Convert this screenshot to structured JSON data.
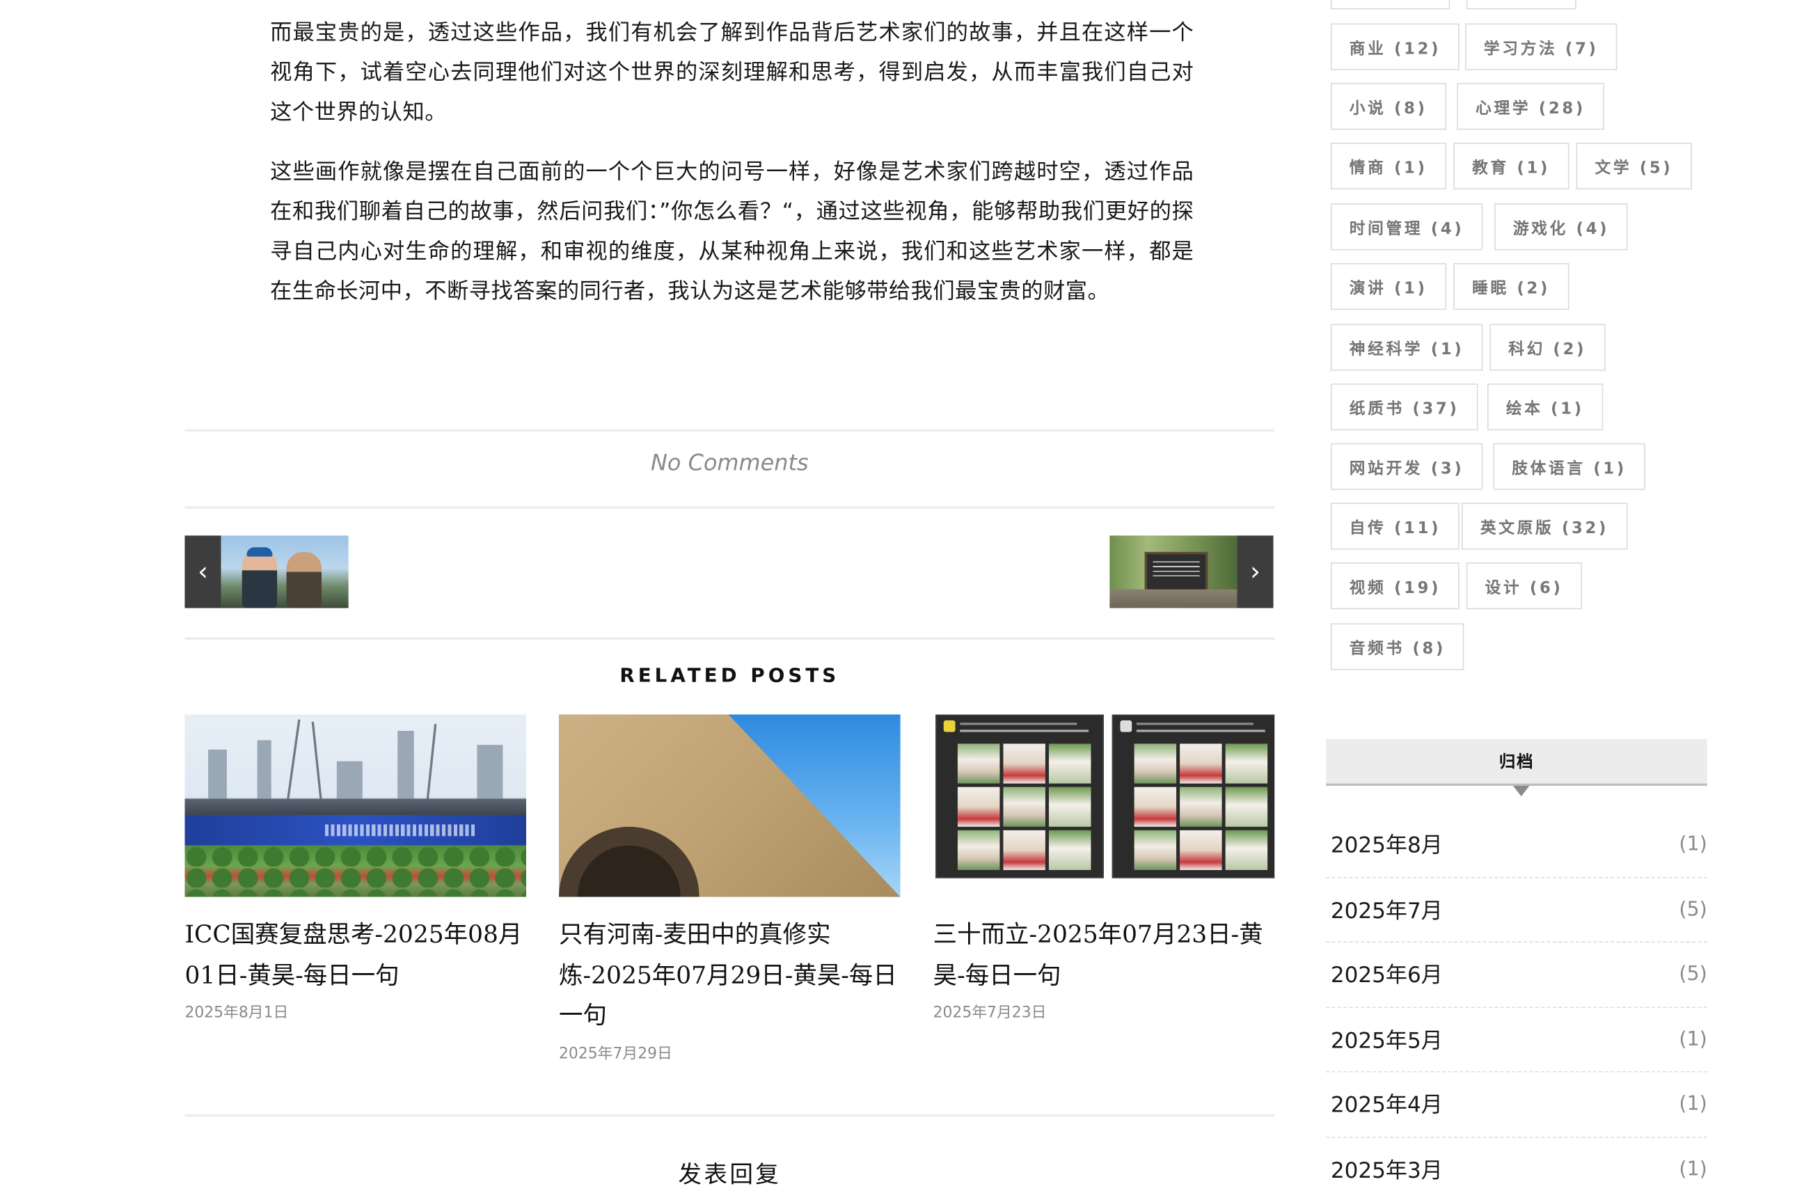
{
  "article": {
    "paragraphs": [
      "而最宝贵的是，透过这些作品，我们有机会了解到作品背后艺术家们的故事，并且在这样一个视角下，试着空心去同理他们对这个世界的深刻理解和思考，得到启发，从而丰富我们自己对这个世界的认知。",
      "这些画作就像是摆在自己面前的一个个巨大的问号一样，好像是艺术家们跨越时空，透过作品在和我们聊着自己的故事，然后问我们：”你怎么看？“，通过这些视角，能够帮助我们更好的探寻自己内心对生命的理解，和审视的维度，从某种视角上来说，我们和这些艺术家一样，都是在生命长河中，不断寻找答案的同行者，我认为这是艺术能够带给我们最宝贵的财富。"
    ]
  },
  "comments": {
    "label": "No Comments"
  },
  "post_nav": {
    "prev_arrow": "‹",
    "next_arrow": "›"
  },
  "related": {
    "heading": "RELATED POSTS",
    "posts": [
      {
        "title": "ICC国赛复盘思考-2025年08月01日-黄昊-每日一句",
        "date": "2025年8月1日"
      },
      {
        "title": "只有河南-麦田中的真修实炼-2025年07月29日-黄昊-每日一句",
        "date": "2025年7月29日"
      },
      {
        "title": "三十而立-2025年07月23日-黄昊-每日一句",
        "date": "2025年7月23日"
      }
    ]
  },
  "reply": {
    "heading": "发表回复"
  },
  "sidebar": {
    "tags": [
      {
        "label": "商业 (12)"
      },
      {
        "label": "学习方法 (7)"
      },
      {
        "label": "小说 (8)"
      },
      {
        "label": "心理学 (28)"
      },
      {
        "label": "情商 (1)"
      },
      {
        "label": "教育 (1)"
      },
      {
        "label": "文学 (5)"
      },
      {
        "label": "时间管理 (4)"
      },
      {
        "label": "游戏化 (4)"
      },
      {
        "label": "演讲 (1)"
      },
      {
        "label": "睡眠 (2)"
      },
      {
        "label": "神经科学 (1)"
      },
      {
        "label": "科幻 (2)"
      },
      {
        "label": "纸质书 (37)"
      },
      {
        "label": "绘本 (1)"
      },
      {
        "label": "网站开发 (3)"
      },
      {
        "label": "肢体语言 (1)"
      },
      {
        "label": "自传 (11)"
      },
      {
        "label": "英文原版 (32)"
      },
      {
        "label": "视频 (19)"
      },
      {
        "label": "设计 (6)"
      },
      {
        "label": "音频书 (8)"
      }
    ],
    "archive": {
      "heading": "归档",
      "items": [
        {
          "month": "2025年8月",
          "count": "(1)"
        },
        {
          "month": "2025年7月",
          "count": "(5)"
        },
        {
          "month": "2025年6月",
          "count": "(5)"
        },
        {
          "month": "2025年5月",
          "count": "(1)"
        },
        {
          "month": "2025年4月",
          "count": "(1)"
        },
        {
          "month": "2025年3月",
          "count": "(1)"
        }
      ]
    }
  }
}
